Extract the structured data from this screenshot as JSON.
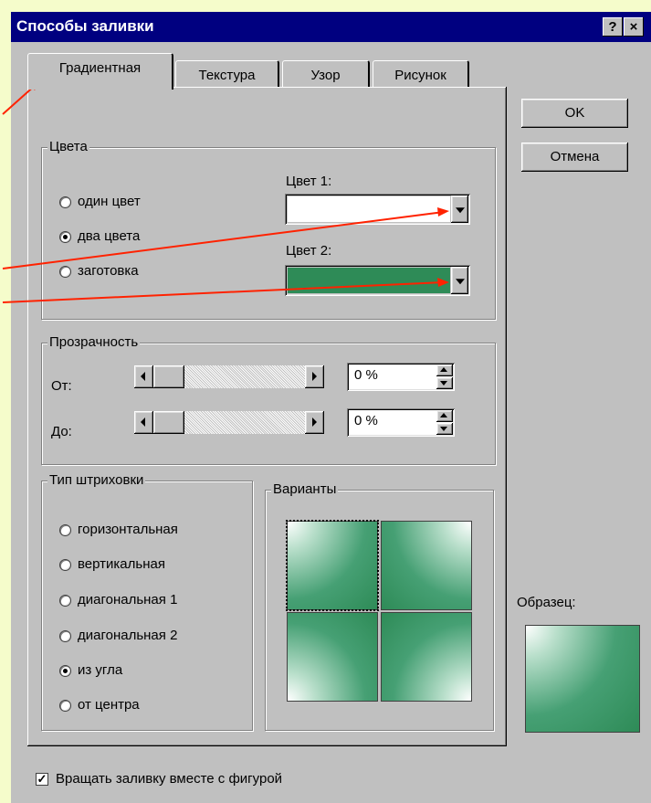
{
  "window": {
    "title": "Способы заливки",
    "help_label": "?",
    "close_label": "×"
  },
  "tabs": [
    {
      "label": "Градиентная",
      "active": true
    },
    {
      "label": "Текстура",
      "active": false
    },
    {
      "label": "Узор",
      "active": false
    },
    {
      "label": "Рисунок",
      "active": false
    }
  ],
  "buttons": {
    "ok": "OK",
    "cancel": "Отмена"
  },
  "colors_group": {
    "legend": "Цвета",
    "options": [
      {
        "label": "один цвет",
        "checked": false
      },
      {
        "label": "два цвета",
        "checked": true
      },
      {
        "label": "заготовка",
        "checked": false
      }
    ],
    "color1": {
      "label": "Цвет 1:",
      "value": "#ffffff"
    },
    "color2": {
      "label": "Цвет 2:",
      "value": "#2e8b57"
    }
  },
  "transparency_group": {
    "legend": "Прозрачность",
    "from": {
      "label": "От:",
      "value": "0 %"
    },
    "to": {
      "label": "До:",
      "value": "0 %"
    }
  },
  "shading_group": {
    "legend": "Тип штриховки",
    "options": [
      {
        "label": "горизонтальная",
        "checked": false
      },
      {
        "label": "вертикальная",
        "checked": false
      },
      {
        "label": "диагональная 1",
        "checked": false
      },
      {
        "label": "диагональная 2",
        "checked": false
      },
      {
        "label": "из угла",
        "checked": true
      },
      {
        "label": "от центра",
        "checked": false
      }
    ]
  },
  "variants_group": {
    "legend": "Варианты",
    "selected_index": 0
  },
  "sample": {
    "label": "Образец:"
  },
  "rotate_checkbox": {
    "label": "Вращать заливку вместе с фигурой",
    "checked": true
  },
  "accent_colors": {
    "titlebar": "#000080",
    "arrow": "#ff2200",
    "background": "#f5fccb"
  }
}
